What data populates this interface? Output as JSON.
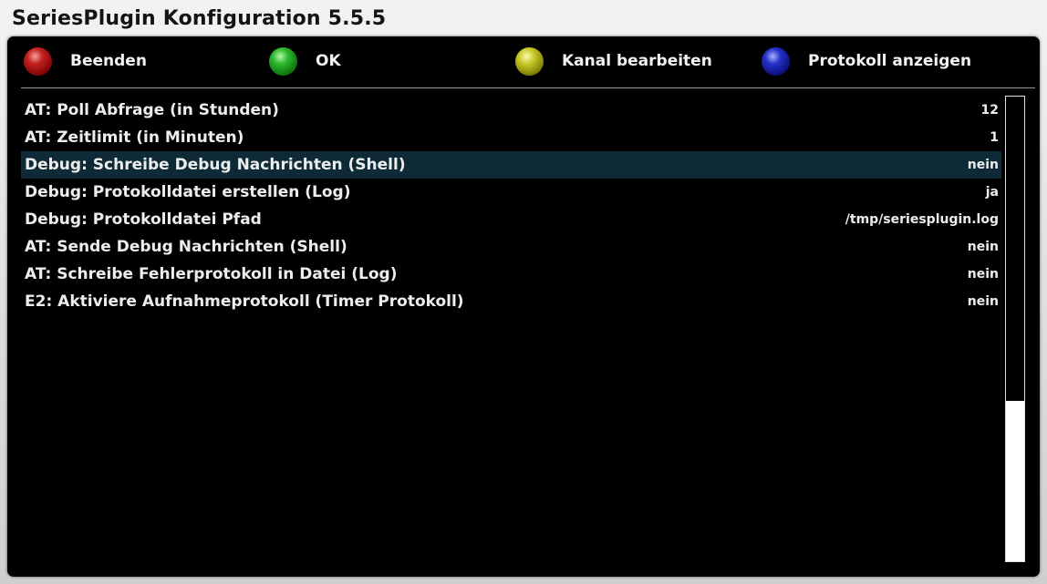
{
  "window": {
    "title": "SeriesPlugin Konfiguration 5.5.5"
  },
  "buttons": {
    "red": {
      "label": "Beenden",
      "color": "#b01818"
    },
    "green": {
      "label": "OK",
      "color": "#22a322"
    },
    "yellow": {
      "label": "Kanal bearbeiten",
      "color": "#b5b520"
    },
    "blue": {
      "label": "Protokoll anzeigen",
      "color": "#1c24b8"
    }
  },
  "settings": {
    "selected_index": 2,
    "selection_color": "#0d2a36",
    "items": [
      {
        "label": "AT: Poll Abfrage (in Stunden)",
        "value": "12"
      },
      {
        "label": "AT: Zeitlimit (in Minuten)",
        "value": "1"
      },
      {
        "label": "Debug: Schreibe Debug Nachrichten (Shell)",
        "value": "nein"
      },
      {
        "label": "Debug: Protokolldatei erstellen (Log)",
        "value": "ja"
      },
      {
        "label": "Debug: Protokolldatei Pfad",
        "value": "/tmp/seriesplugin.log"
      },
      {
        "label": "AT: Sende Debug Nachrichten (Shell)",
        "value": "nein"
      },
      {
        "label": "AT: Schreibe Fehlerprotokoll in Datei (Log)",
        "value": "nein"
      },
      {
        "label": "E2: Aktiviere Aufnahmeprotokoll (Timer Protokoll)",
        "value": "nein"
      }
    ]
  },
  "scrollbar": {
    "thumb_fraction": 0.655
  }
}
